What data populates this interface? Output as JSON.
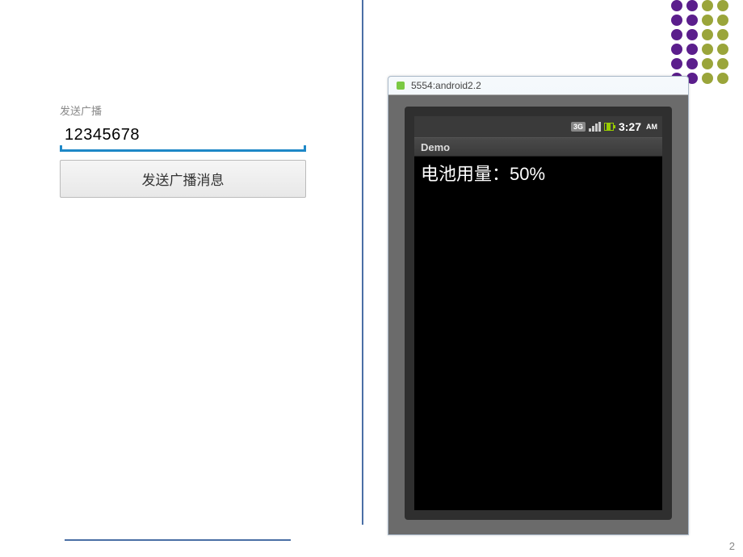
{
  "dots_rows": [
    [
      "purple",
      "purple",
      "olive",
      "olive"
    ],
    [
      "purple",
      "purple",
      "olive",
      "olive"
    ],
    [
      "purple",
      "purple",
      "olive",
      "olive"
    ],
    [
      "purple",
      "purple",
      "olive",
      "olive"
    ],
    [
      "purple",
      "purple",
      "olive",
      "olive"
    ],
    [
      "purple",
      "purple",
      "olive",
      "olive"
    ]
  ],
  "left_form": {
    "label": "发送广播",
    "input_value": "12345678",
    "button_label": "发送广播消息"
  },
  "emulator": {
    "window_title": "5554:android2.2",
    "statusbar": {
      "network_badge": "3G",
      "time": "3:27",
      "ampm": "AM"
    },
    "app_title": "Demo",
    "content_text": "电池用量：50%"
  },
  "page_number": "2"
}
